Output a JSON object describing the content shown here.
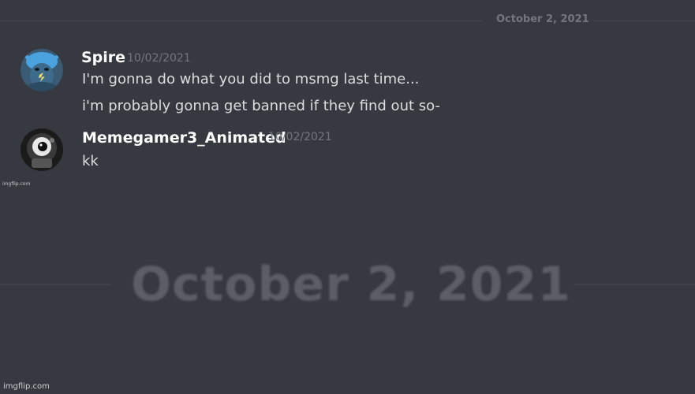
{
  "divider": {
    "date": "October 2, 2021"
  },
  "messages": [
    {
      "author": "Spire",
      "timestamp": "10/02/2021",
      "lines": [
        "I'm gonna do what you did to msmg last time...",
        "i'm probably gonna get banned if they find out so-"
      ],
      "avatar_icon": "blue-creature-avatar",
      "avatar_color": "#4aa3df"
    },
    {
      "author": "Memegamer3_Animated",
      "timestamp": "10/02/2021",
      "lines": [
        "kk"
      ],
      "avatar_icon": "dark-eyeball-avatar",
      "avatar_color": "#2a2a2a"
    }
  ],
  "zoom_caption": {
    "date": "October 2, 2021"
  },
  "watermark": {
    "small": "imgflip.com",
    "bottom": "imgflip.com"
  },
  "colors": {
    "background": "#36393f",
    "username": "#ffffff",
    "message_text": "#dcddde",
    "muted": "#72767d"
  }
}
